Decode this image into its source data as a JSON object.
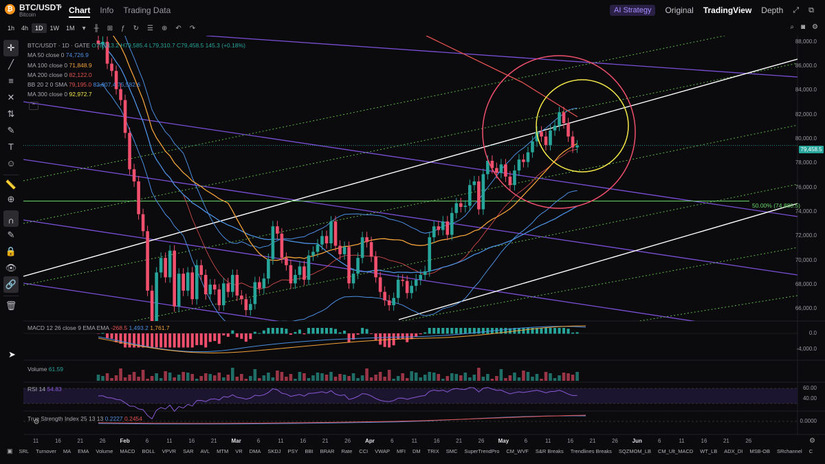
{
  "header": {
    "coin_icon": "bitcoin-icon",
    "pair": "BTC/USDT",
    "pair_sub": "Bitcoin",
    "tabs": [
      "Chart",
      "Info",
      "Trading Data"
    ],
    "active_tab": "Chart",
    "ai_strategy": "AI Strategy",
    "views": [
      "Original",
      "TradingView",
      "Depth"
    ],
    "active_view": "TradingView"
  },
  "toolbar": {
    "timeframes": [
      "1h",
      "4h",
      "1D",
      "1W",
      "1M"
    ],
    "active_timeframe": "1D"
  },
  "legend": {
    "symbol": "BTC/USDT · 1D · GATE",
    "ohlc": "O79,313.2 H79,585.4 L79,310.7 C79,458.5 145.3 (+0.18%)",
    "ma50": {
      "name": "MA 50 close 0",
      "value": "74,726.9",
      "color": "#4b8fe0"
    },
    "ma100": {
      "name": "MA 100 close 0",
      "value": "71,848.9",
      "color": "#f2a23a"
    },
    "ma200": {
      "name": "MA 200 close 0",
      "value": "82,122.0",
      "color": "#e35252"
    },
    "bb": {
      "name": "BB 20 2 0 SMA",
      "v1": "79,195.0",
      "v2": "82,807.4",
      "v3": "75,582.6",
      "color": "#4b8fe0"
    },
    "ma300": {
      "name": "MA 300 close 0",
      "value": "92,972.7",
      "color": "#f5e94a"
    }
  },
  "price_axis": [
    "88,000.0",
    "86,000.0",
    "84,000.0",
    "82,000.0",
    "80,000.0",
    "78,000.0",
    "76,000.0",
    "74,000.0",
    "72,000.0",
    "70,000.0",
    "68,000.0",
    "66,000.0"
  ],
  "last_price": "79,458.5",
  "fib_label": "50.00% (74,880.5)",
  "macd": {
    "name": "MACD 12 26 close 9 EMA EMA",
    "v1": "-268.5",
    "v2": "1,493.2",
    "v3": "1,761.7",
    "axis": [
      "0.0",
      "-4,000.0"
    ]
  },
  "volume": {
    "name": "Volume",
    "value": "61.59"
  },
  "rsi": {
    "name": "RSI 14",
    "value": "54.83",
    "axis": [
      "60.00",
      "40.00"
    ]
  },
  "tsi": {
    "name": "True Strength Index 25 13 13",
    "v1": "0.2227",
    "v2": "0.2454",
    "axis": [
      "0.0000"
    ]
  },
  "time_axis": [
    {
      "t": "11",
      "b": false
    },
    {
      "t": "16",
      "b": false
    },
    {
      "t": "21",
      "b": false
    },
    {
      "t": "26",
      "b": false
    },
    {
      "t": "Feb",
      "b": true
    },
    {
      "t": "6",
      "b": false
    },
    {
      "t": "11",
      "b": false
    },
    {
      "t": "16",
      "b": false
    },
    {
      "t": "21",
      "b": false
    },
    {
      "t": "Mar",
      "b": true
    },
    {
      "t": "6",
      "b": false
    },
    {
      "t": "11",
      "b": false
    },
    {
      "t": "16",
      "b": false
    },
    {
      "t": "21",
      "b": false
    },
    {
      "t": "26",
      "b": false
    },
    {
      "t": "Apr",
      "b": true
    },
    {
      "t": "6",
      "b": false
    },
    {
      "t": "11",
      "b": false
    },
    {
      "t": "16",
      "b": false
    },
    {
      "t": "21",
      "b": false
    },
    {
      "t": "26",
      "b": false
    },
    {
      "t": "May",
      "b": true
    },
    {
      "t": "6",
      "b": false
    },
    {
      "t": "11",
      "b": false
    },
    {
      "t": "16",
      "b": false
    },
    {
      "t": "21",
      "b": false
    },
    {
      "t": "26",
      "b": false
    },
    {
      "t": "Jun",
      "b": true
    },
    {
      "t": "6",
      "b": false
    },
    {
      "t": "11",
      "b": false
    },
    {
      "t": "16",
      "b": false
    },
    {
      "t": "21",
      "b": false
    },
    {
      "t": "26",
      "b": false
    }
  ],
  "indicators_bar": [
    "SRL",
    "Turnover",
    "MA",
    "EMA",
    "Volume",
    "MACD",
    "BOLL",
    "VPVR",
    "SAR",
    "AVL",
    "MTM",
    "VR",
    "DMA",
    "SKDJ",
    "PSY",
    "BBI",
    "BRAR",
    "Rate",
    "CCI",
    "VWAP",
    "MFI",
    "DM",
    "TRIX",
    "SMC",
    "SuperTrendPro",
    "CM_WVF",
    "S&R Breaks",
    "Trendlines Breaks",
    "SQZMOM_LB",
    "CM_Ult_MACD",
    "WT_LB",
    "ADX_DI",
    "MSB-OB",
    "SRchannel",
    "C"
  ],
  "chart_data": {
    "type": "candlestick",
    "symbol": "BTC/USDT",
    "timeframe": "1D",
    "ylim": [
      65000,
      88500
    ],
    "close_series": [
      87800,
      88000,
      86200,
      85600,
      84100,
      83200,
      80500,
      77500,
      76500,
      73800,
      72400,
      67500,
      64000,
      69000,
      70200,
      68600,
      70800,
      66200,
      68900,
      67500,
      69000,
      66800,
      69600,
      68800,
      67200,
      68000,
      67600,
      66300,
      68100,
      67400,
      68800,
      67100,
      66800,
      65900,
      66400,
      68200,
      67700,
      68500,
      70100,
      72800,
      72200,
      70200,
      69600,
      68100,
      68800,
      69500,
      68400,
      70400,
      70700,
      71300,
      72000,
      71400,
      73200,
      71200,
      70500,
      71100,
      68100,
      68900,
      70200,
      71900,
      71500,
      70300,
      68600,
      67400,
      66700,
      66300,
      66900,
      68400,
      68300,
      67300,
      67900,
      68400,
      68800,
      69100,
      71900,
      72800,
      72500,
      73200,
      72100,
      73900,
      74700,
      74400,
      74500,
      76200,
      76500,
      74200,
      77100,
      78200,
      77600,
      77200,
      77900,
      76900,
      76200,
      77400,
      78300,
      78100,
      78900,
      79800,
      80600,
      80200,
      79500,
      80700,
      81100,
      82200,
      81300,
      80200,
      79300,
      79458
    ]
  }
}
